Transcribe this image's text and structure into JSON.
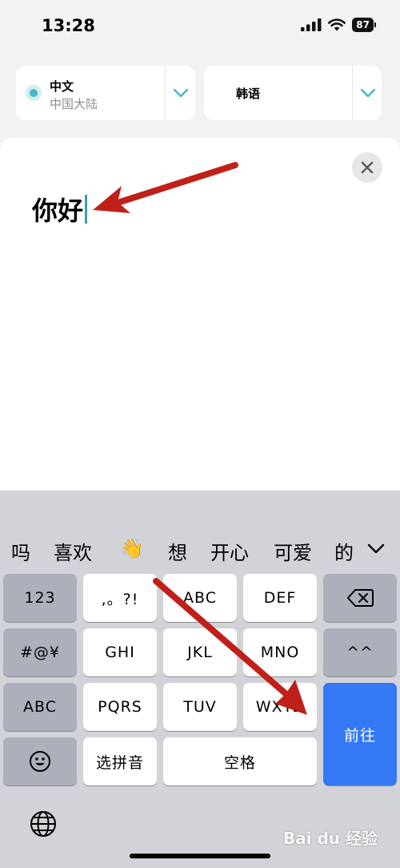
{
  "status": {
    "time": "13:28",
    "battery": "87"
  },
  "language": {
    "source_name": "中文",
    "source_region": "中国大陆",
    "target_name": "韩语"
  },
  "input": {
    "text": "你好"
  },
  "keyboard": {
    "candidates": [
      "吗",
      "喜欢",
      "👋",
      "想",
      "开心",
      "可爱",
      "的"
    ],
    "keys": {
      "num": "123",
      "punct": ",。?!",
      "abc2": "ABC",
      "def3": "DEF",
      "sym": "#@¥",
      "ghi": "GHI",
      "jkl": "JKL",
      "mno": "MNO",
      "face": "^^",
      "abc_mode": "ABC",
      "pqrs": "PQRS",
      "tuv": "TUV",
      "wxyz": "WXYZ",
      "go": "前往",
      "pinyin": "选拼音",
      "space": "空格"
    }
  },
  "watermark": "Bai du 经验",
  "colors": {
    "accent": "#3478f6",
    "annotation_arrow": "#c0201a",
    "caret": "#34a0b8"
  }
}
